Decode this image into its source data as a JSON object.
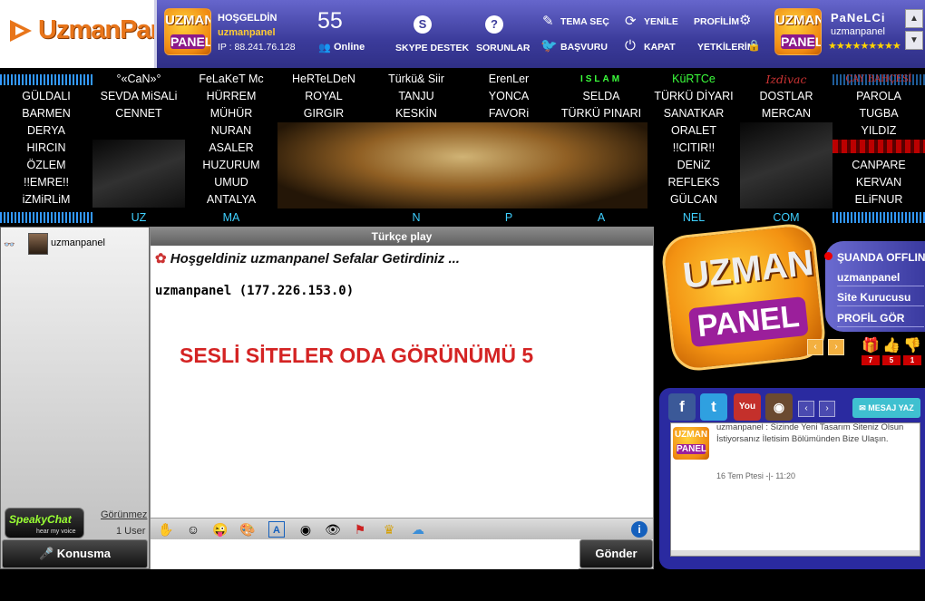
{
  "header": {
    "logo_text": "UzmanPanel",
    "welcome_label": "HOŞGELDİN",
    "username": "uzmanpanel",
    "ip_label": "IP : 88.241.76.128",
    "online_count": "55",
    "online_label": "Online",
    "skype_label": "SKYPE DESTEK",
    "sorunlar_label": "SORUNLAR",
    "tema_label": "TEMA SEÇ",
    "basvuru_label": "BAŞVURU",
    "yenile_label": "YENİLE",
    "kapat_label": "KAPAT",
    "profilim_label": "PROFİLİM",
    "yetkilerim_label": "YETKİLERİM",
    "badge_top": "UZMAN",
    "badge_bottom": "PANEL",
    "panel_title": "PaNeLCi",
    "panel_user": "uzmanpanel",
    "stars": "★★★★★★★★★",
    "scroll_up": "▲",
    "scroll_down": "▼"
  },
  "rooms": {
    "row0": [
      "",
      "°«CaN»°",
      "FeLaKeT Mc",
      "HeRTeLDeN",
      "Türkü& Siir",
      "ErenLer",
      "ISLAM",
      "KüRTCe",
      "Izdivac",
      "ÇAY BAHÇESİ"
    ],
    "row1": [
      "GÜLDALI",
      "SEVDA MiSALi",
      "HÜRREM",
      "ROYAL",
      "TANJU",
      "YONCA",
      "SELDA",
      "TÜRKÜ DİYARI",
      "DOSTLAR",
      "PAROLA"
    ],
    "row2": [
      "BARMEN",
      "CENNET",
      "MÜHÜR",
      "GIRGIR",
      "KESKİN",
      "FAVORi",
      "TÜRKÜ PINARI",
      "SANATKAR",
      "MERCAN",
      "TUGBA"
    ],
    "row3": [
      "DERYA",
      "",
      "NURAN",
      "",
      "",
      "",
      "",
      "ORALET",
      "",
      "YILDIZ"
    ],
    "row4": [
      "HIRCIN",
      "",
      "ASALER",
      "",
      "",
      "",
      "",
      "!!CITIR!!",
      "",
      ""
    ],
    "row5": [
      "ÖZLEM",
      "",
      "HUZURUM",
      "",
      "",
      "",
      "",
      "DENiZ",
      "",
      "CANPARE"
    ],
    "row6": [
      "!!EMRE!!",
      "",
      "UMUD",
      "",
      "",
      "",
      "",
      "REFLEKS",
      "",
      "KERVAN"
    ],
    "row7": [
      "iZMiRLiM",
      "",
      "ANTALYA",
      "",
      "",
      "",
      "",
      "GÜLCAN",
      "",
      "ELiFNUR"
    ],
    "row8": [
      "",
      "UZ",
      "MA",
      "",
      "N",
      "P",
      "A",
      "NEL",
      "COM",
      ""
    ]
  },
  "userpanel": {
    "user": "uzmanpanel",
    "speaky_title": "SpeakyChat",
    "speaky_sub": "hear my voice",
    "gorunmez": "Görünmez",
    "count": "1 User",
    "konusma": "Konusma"
  },
  "chat": {
    "title": "Türkçe play",
    "welcome": "Hoşgeldiniz uzmanpanel Sefalar Getirdiniz ...",
    "ip_line": "uzmanpanel (177.226.153.0)",
    "overlay": "SESLİ SİTELER ODA GÖRÜNÜMÜ 5",
    "send": "Gönder"
  },
  "rightpanel": {
    "badge_top": "UZMAN",
    "badge_bottom": "PANEL",
    "status": "ŞUANDA OFFLINE",
    "user": "uzmanpanel",
    "kurucu": "Site Kurucusu",
    "profil": "PROFİL GÖR",
    "gift_count": "7",
    "like_count": "5",
    "dislike_count": "1",
    "prev": "‹",
    "next": "›"
  },
  "social": {
    "mesaj": "MESAJ YAZ",
    "feed_badge_top": "UZMAN",
    "feed_badge_bottom": "PANEL",
    "feed_text": "uzmanpanel : Sizinde Yeni Tasarım Siteniz Olsun İstiyorsanız İletisim Bölümünden Bize Ulaşın.",
    "feed_time": "16 Tem Ptesi -|- 11:20"
  }
}
